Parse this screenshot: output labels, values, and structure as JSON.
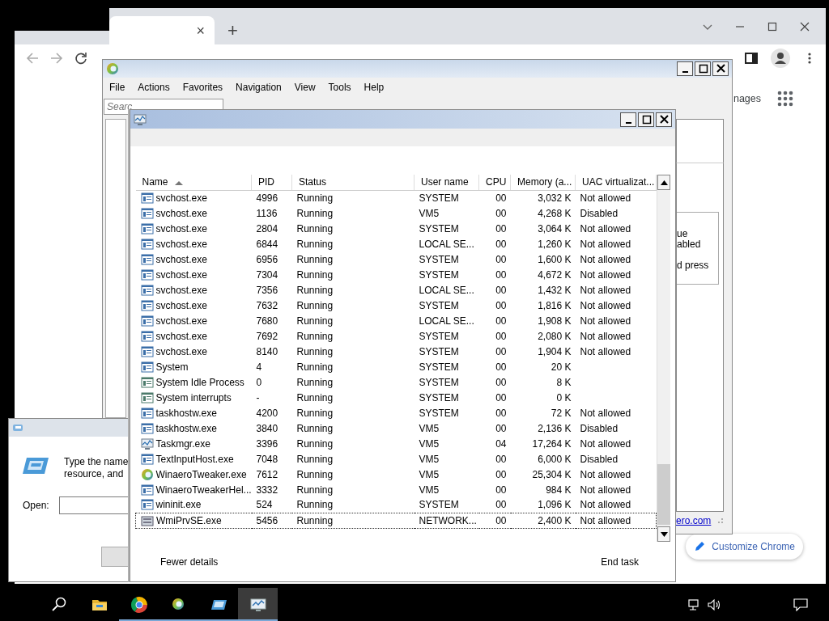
{
  "browser": {
    "tab_close": "×",
    "new_tab": "+",
    "partial_link": "nages",
    "customize_button": "Customize Chrome"
  },
  "winaero": {
    "menu": [
      "File",
      "Actions",
      "Favorites",
      "Navigation",
      "View",
      "Tools",
      "Help"
    ],
    "search_placeholder": "Searc",
    "panel_lines": [
      "ue",
      "abled",
      "d press"
    ],
    "link": "ero.com"
  },
  "run_dialog": {
    "lines": [
      "Type the name",
      "resource, and"
    ],
    "open_label": "Open:"
  },
  "task_manager": {
    "columns": [
      {
        "label": "Name",
        "sorted": true
      },
      {
        "label": "PID"
      },
      {
        "label": "Status"
      },
      {
        "label": "User name"
      },
      {
        "label": "CPU"
      },
      {
        "label": "Memory (a..."
      },
      {
        "label": "UAC virtualizat..."
      }
    ],
    "rows": [
      {
        "kind": "service",
        "name": "svchost.exe",
        "pid": "4996",
        "status": "Running",
        "user": "SYSTEM",
        "cpu": "00",
        "memory": "3,032 K",
        "uac": "Not allowed",
        "selected": false
      },
      {
        "kind": "service",
        "name": "svchost.exe",
        "pid": "1136",
        "status": "Running",
        "user": "VM5",
        "cpu": "00",
        "memory": "4,268 K",
        "uac": "Disabled",
        "selected": false
      },
      {
        "kind": "service",
        "name": "svchost.exe",
        "pid": "2804",
        "status": "Running",
        "user": "SYSTEM",
        "cpu": "00",
        "memory": "3,064 K",
        "uac": "Not allowed",
        "selected": false
      },
      {
        "kind": "service",
        "name": "svchost.exe",
        "pid": "6844",
        "status": "Running",
        "user": "LOCAL SE...",
        "cpu": "00",
        "memory": "1,260 K",
        "uac": "Not allowed",
        "selected": false
      },
      {
        "kind": "service",
        "name": "svchost.exe",
        "pid": "6956",
        "status": "Running",
        "user": "SYSTEM",
        "cpu": "00",
        "memory": "1,600 K",
        "uac": "Not allowed",
        "selected": false
      },
      {
        "kind": "service",
        "name": "svchost.exe",
        "pid": "7304",
        "status": "Running",
        "user": "SYSTEM",
        "cpu": "00",
        "memory": "4,672 K",
        "uac": "Not allowed",
        "selected": false
      },
      {
        "kind": "service",
        "name": "svchost.exe",
        "pid": "7356",
        "status": "Running",
        "user": "LOCAL SE...",
        "cpu": "00",
        "memory": "1,432 K",
        "uac": "Not allowed",
        "selected": false
      },
      {
        "kind": "service",
        "name": "svchost.exe",
        "pid": "7632",
        "status": "Running",
        "user": "SYSTEM",
        "cpu": "00",
        "memory": "1,816 K",
        "uac": "Not allowed",
        "selected": false
      },
      {
        "kind": "service",
        "name": "svchost.exe",
        "pid": "7680",
        "status": "Running",
        "user": "LOCAL SE...",
        "cpu": "00",
        "memory": "1,908 K",
        "uac": "Not allowed",
        "selected": false
      },
      {
        "kind": "service",
        "name": "svchost.exe",
        "pid": "7692",
        "status": "Running",
        "user": "SYSTEM",
        "cpu": "00",
        "memory": "2,080 K",
        "uac": "Not allowed",
        "selected": false
      },
      {
        "kind": "service",
        "name": "svchost.exe",
        "pid": "8140",
        "status": "Running",
        "user": "SYSTEM",
        "cpu": "00",
        "memory": "1,904 K",
        "uac": "Not allowed",
        "selected": false
      },
      {
        "kind": "service",
        "name": "System",
        "pid": "4",
        "status": "Running",
        "user": "SYSTEM",
        "cpu": "00",
        "memory": "20 K",
        "selected": false
      },
      {
        "kind": "system",
        "name": "System Idle Process",
        "pid": "0",
        "status": "Running",
        "user": "SYSTEM",
        "cpu": "00",
        "memory": "8 K",
        "selected": false
      },
      {
        "kind": "system",
        "name": "System interrupts",
        "pid": "-",
        "status": "Running",
        "user": "SYSTEM",
        "cpu": "00",
        "memory": "0 K",
        "selected": false
      },
      {
        "kind": "service",
        "name": "taskhostw.exe",
        "pid": "4200",
        "status": "Running",
        "user": "SYSTEM",
        "cpu": "00",
        "memory": "72 K",
        "uac": "Not allowed",
        "selected": false
      },
      {
        "kind": "service",
        "name": "taskhostw.exe",
        "pid": "3840",
        "status": "Running",
        "user": "VM5",
        "cpu": "00",
        "memory": "2,136 K",
        "uac": "Disabled",
        "selected": false
      },
      {
        "kind": "taskmgr",
        "name": "Taskmgr.exe",
        "pid": "3396",
        "status": "Running",
        "user": "VM5",
        "cpu": "04",
        "memory": "17,264 K",
        "uac": "Not allowed",
        "selected": false
      },
      {
        "kind": "service",
        "name": "TextInputHost.exe",
        "pid": "7048",
        "status": "Running",
        "user": "VM5",
        "cpu": "00",
        "memory": "6,000 K",
        "uac": "Disabled",
        "selected": false
      },
      {
        "kind": "winaero",
        "name": "WinaeroTweaker.exe",
        "pid": "7612",
        "status": "Running",
        "user": "VM5",
        "cpu": "00",
        "memory": "25,304 K",
        "uac": "Not allowed",
        "selected": false
      },
      {
        "kind": "service",
        "name": "WinaeroTweakerHel...",
        "pid": "3332",
        "status": "Running",
        "user": "VM5",
        "cpu": "00",
        "memory": "984 K",
        "uac": "Not allowed",
        "selected": false
      },
      {
        "kind": "service",
        "name": "wininit.exe",
        "pid": "524",
        "status": "Running",
        "user": "SYSTEM",
        "cpu": "00",
        "memory": "1,096 K",
        "uac": "Not allowed",
        "selected": false
      },
      {
        "kind": "wmi",
        "name": "WmiPrvSE.exe",
        "pid": "5456",
        "status": "Running",
        "user": "NETWORK...",
        "cpu": "00",
        "memory": "2,400 K",
        "uac": "Not allowed",
        "selected": true
      }
    ],
    "fewer_details": "Fewer details",
    "end_task": "End task"
  },
  "taskbar": {
    "apps": [
      {
        "kind": "search",
        "running": false,
        "active": false
      },
      {
        "kind": "explorer",
        "running": false,
        "active": false
      },
      {
        "kind": "chrome",
        "running": true,
        "active": false
      },
      {
        "kind": "winaero",
        "running": true,
        "active": false
      },
      {
        "kind": "run",
        "running": true,
        "active": false
      },
      {
        "kind": "taskmgr",
        "running": true,
        "active": true
      }
    ]
  }
}
